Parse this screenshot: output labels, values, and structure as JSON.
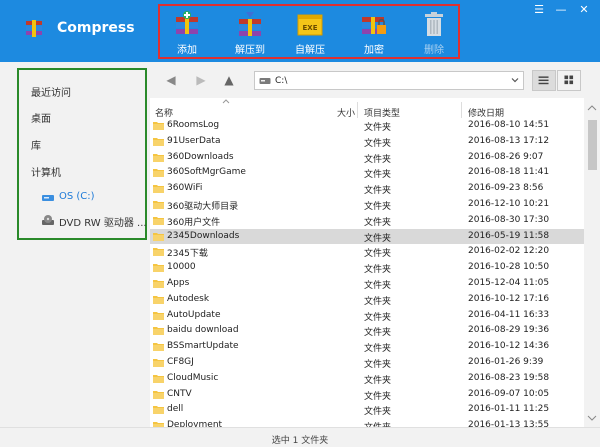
{
  "app": {
    "title": "Compress",
    "accent": "#1d8ae0",
    "highlight_box_color": "#e03030",
    "sidebar_box_color": "#2a8a2a"
  },
  "toolbar": {
    "items": [
      {
        "label": "添加",
        "icon": "add-archive-icon",
        "enabled": true
      },
      {
        "label": "解压到",
        "icon": "extract-to-icon",
        "enabled": true
      },
      {
        "label": "自解压",
        "icon": "self-extract-exe-icon",
        "enabled": true
      },
      {
        "label": "加密",
        "icon": "encrypt-icon",
        "enabled": true
      },
      {
        "label": "删除",
        "icon": "trash-icon",
        "enabled": false
      }
    ]
  },
  "window_controls": {
    "menu": "☰",
    "minimize": "—",
    "close": "✕"
  },
  "nav": {
    "path": "C:\\",
    "back": "◀",
    "forward": "▶",
    "up": "▲"
  },
  "sidebar": {
    "items": [
      {
        "label": "最近访问"
      },
      {
        "label": "桌面"
      },
      {
        "label": "库"
      },
      {
        "label": "计算机"
      }
    ],
    "drives": [
      {
        "label": "OS (C:)",
        "icon": "hard-drive-icon",
        "active": true
      },
      {
        "label": "DVD RW 驱动器 ...",
        "icon": "dvd-drive-icon",
        "active": false
      }
    ]
  },
  "columns": {
    "name": "名称",
    "size": "大小",
    "type": "项目类型",
    "date": "修改日期"
  },
  "files": [
    {
      "name": "6RoomsLog",
      "type": "文件夹",
      "date": "2016-08-10 14:51"
    },
    {
      "name": "91UserData",
      "type": "文件夹",
      "date": "2016-08-13 17:12"
    },
    {
      "name": "360Downloads",
      "type": "文件夹",
      "date": "2016-08-26 9:07"
    },
    {
      "name": "360SoftMgrGame",
      "type": "文件夹",
      "date": "2016-08-18 11:41"
    },
    {
      "name": "360WiFi",
      "type": "文件夹",
      "date": "2016-09-23 8:56"
    },
    {
      "name": "360驱动大师目录",
      "type": "文件夹",
      "date": "2016-12-10 10:21"
    },
    {
      "name": "360用户文件",
      "type": "文件夹",
      "date": "2016-08-30 17:30"
    },
    {
      "name": "2345Downloads",
      "type": "文件夹",
      "date": "2016-05-19 11:58",
      "selected": true
    },
    {
      "name": "2345下载",
      "type": "文件夹",
      "date": "2016-02-02 12:20"
    },
    {
      "name": "10000",
      "type": "文件夹",
      "date": "2016-10-28 10:50"
    },
    {
      "name": "Apps",
      "type": "文件夹",
      "date": "2015-12-04 11:05"
    },
    {
      "name": "Autodesk",
      "type": "文件夹",
      "date": "2016-10-12 17:16"
    },
    {
      "name": "AutoUpdate",
      "type": "文件夹",
      "date": "2016-04-11 16:33"
    },
    {
      "name": "baidu download",
      "type": "文件夹",
      "date": "2016-08-29 19:36"
    },
    {
      "name": "BSSmartUpdate",
      "type": "文件夹",
      "date": "2016-10-12 14:36"
    },
    {
      "name": "CF8GJ",
      "type": "文件夹",
      "date": "2016-01-26 9:39"
    },
    {
      "name": "CloudMusic",
      "type": "文件夹",
      "date": "2016-08-23 19:58"
    },
    {
      "name": "CNTV",
      "type": "文件夹",
      "date": "2016-09-07 10:05"
    },
    {
      "name": "dell",
      "type": "文件夹",
      "date": "2016-01-11 11:25"
    },
    {
      "name": "Deployment",
      "type": "文件夹",
      "date": "2016-01-13 13:55"
    }
  ],
  "status": {
    "text": "选中 1 文件夹"
  }
}
